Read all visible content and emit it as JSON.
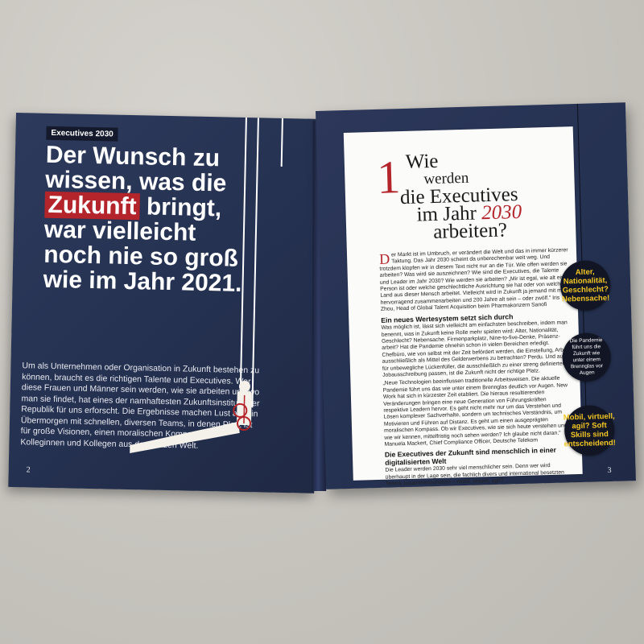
{
  "left_page": {
    "tag": "Executives 2030",
    "headline_before": "Der Wunsch zu wissen, was die ",
    "headline_highlight": "Zukunft",
    "headline_after": " bringt, war vielleicht noch nie so groß wie im Jahr 2021.",
    "intro": "Um als Unternehmen oder Organisation in Zukunft bestehen zu können, braucht es die richtigen Talente und Executives. Wer diese Frauen und Männer sein werden, wie sie arbeiten und wo man sie findet, hat eines der namhaftesten Zukunftsinstitute der Republik für uns erforscht. Die Ergebnisse machen Lust auf ein Übermorgen mit schnellen, diversen Teams, in denen Platz ist für große Visionen, einen moralischen Kompass und Kolleginnen und Kollegen aus der ganzen Welt.",
    "page_number": "2"
  },
  "right_page": {
    "number": "1",
    "title_1": "Wie",
    "title_2": "werden",
    "title_3": "die Executives",
    "title_4": "im Jahr",
    "title_year": "2030",
    "title_5": "arbeiten?",
    "dropcap": "D",
    "lead": "er Markt ist im Umbruch, er verändert die Welt und das in immer kürzerer Taktung. Das Jahr 2030 scheint da unberechenbar weit weg. Und trotzdem klopfen wir in diesem Text nicht nur an die Tür. Wie offen werden sie arbeiten? Was wird sie auszeichnen? Wie sind die Executives, die Talente und Leader im Jahr 2030? Wie werden sie arbeiten? „Mir ist egal, wie alt eine Person ist oder welche geschlechtliche Ausrichtung sie hat oder von welchem Land aus dieser Mensch arbeitet. Vielleicht wird in Zukunft ja jemand mit mir hervorragend zusammenarbeiten und 200 Jahre alt sein – oder zwölf.\" Iris Zhou, Head of Global Talent Acquisition beim Pharmakonzern Sanofi",
    "h1": "Ein neues Wertesystem setzt sich durch",
    "p1": "Was möglich ist, lässt sich vielleicht am einfachsten beschreiben, indem man benennt, was in Zukunft keine Rolle mehr spielen wird: Alter, Nationalität, Geschlecht? Nebensache. Firmenparkplatz, Nine-to-five-Denke, Präsenz-arbeit? Hat die Pandemie ohnehin schon in vielen Bereichen erledigt. Chefbüro, wie von selbst mit der Zeit befördert werden, die Einstellung, Arbeit ausschließlich als Mittel des Gelderwerbens zu betrachten? Perdu. Und auch für unbewegliche Lückenfüller, die ausschließlich zu einer streng definierten Jobausschreibung passen, ist die Zukunft nicht der richtige Platz.",
    "p2": "„Neue Technologien beeinflussen traditionelle Arbeitsweisen. Die aktuelle Pandemie führt uns das wie unter einem Brennglas deutlich vor Augen. New Work hat sich in kürzester Zeit etabliert. Die hieraus resultierenden Veränderungen bringen eine neue Generation von Führungskräften respektive Leadern hervor. Es geht nicht mehr nur um das Verstehen und Lösen komplexer Sachverhalte, sondern um technisches Verständnis, um Motivieren und Führen auf Distanz. Es geht um einen ausgeprägten moralischen Kompass. Ob wir Executives, wie sie sich heute verstehen und wie wir kennen, mittelfristig noch sehen werden? Ich glaube nicht daran.\" Manuela Mackert, Chief Compliance Officer, Deutsche Telekom",
    "h2": "Die Executives der Zukunft sind menschlich in einer digitalisierten Welt",
    "p3": "Die Leader werden 2030 sehr viel menschlicher sein. Denn wer wird überhaupt in der Lage sein, die fachlich divers und international besetzten Teams zusammenzuhalten – mobil, virtuell, agil?",
    "bubble_1": "Alter, Nationalität, Geschlecht? Nebensache!",
    "bubble_2": "Die Pandemie führt uns die Zukunft wie unter einem Brennglas vor Augen",
    "bubble_3": "Mobil, virtuell, agil? Soft Skills sind entscheidend!",
    "page_number": "3"
  },
  "colors": {
    "page_navy": "#253150",
    "accent_red": "#b3242b",
    "bubble_yellow": "#f2c624"
  }
}
